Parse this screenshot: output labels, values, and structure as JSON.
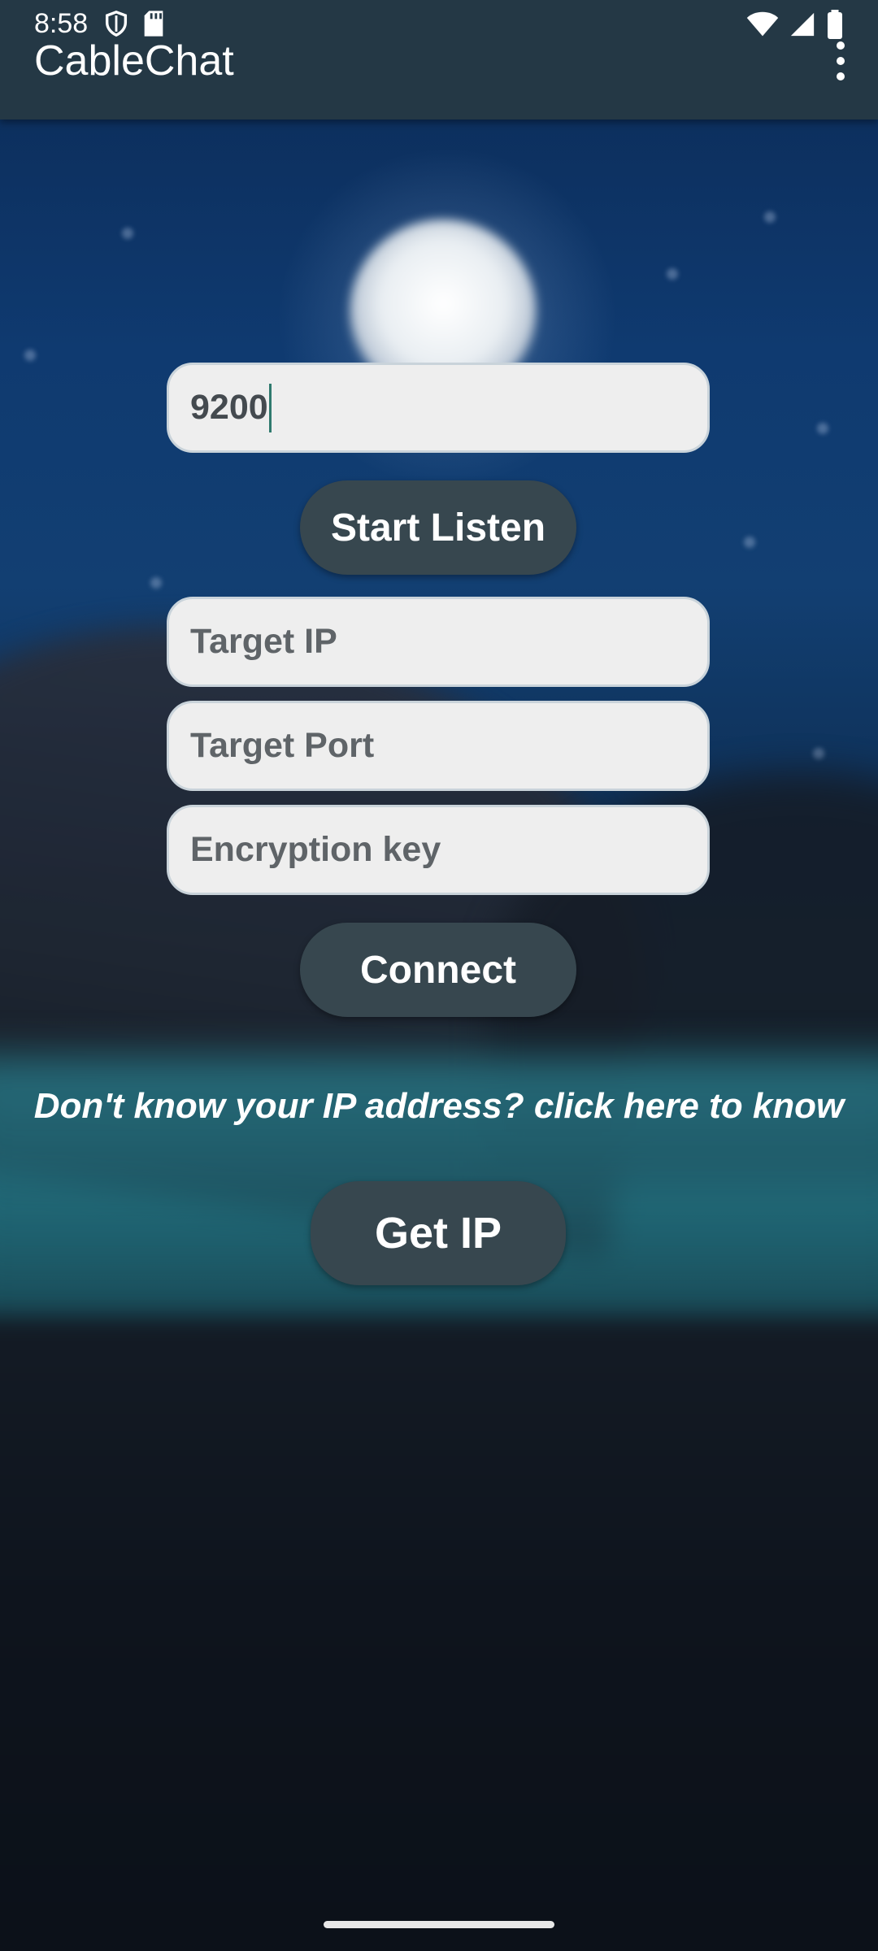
{
  "status_bar": {
    "time": "8:58",
    "left_icons": [
      "shield-icon",
      "sd-card-icon"
    ],
    "right_icons": [
      "wifi-icon",
      "signal-icon",
      "battery-icon"
    ]
  },
  "app_bar": {
    "title": "CableChat",
    "menu_icon": "more-vert-icon"
  },
  "listen": {
    "port_value": "9200",
    "button_label": "Start Listen"
  },
  "connect": {
    "target_ip_placeholder": "Target IP",
    "target_port_placeholder": "Target Port",
    "encryption_key_placeholder": "Encryption key",
    "button_label": "Connect"
  },
  "ip_help": {
    "hint_text": "Don't know your IP address? click here to know",
    "button_label": "Get IP"
  },
  "colors": {
    "app_bar": "#243845",
    "button": "#37474f",
    "field_background": "#eeeeee",
    "cursor": "#2f7a6e"
  }
}
